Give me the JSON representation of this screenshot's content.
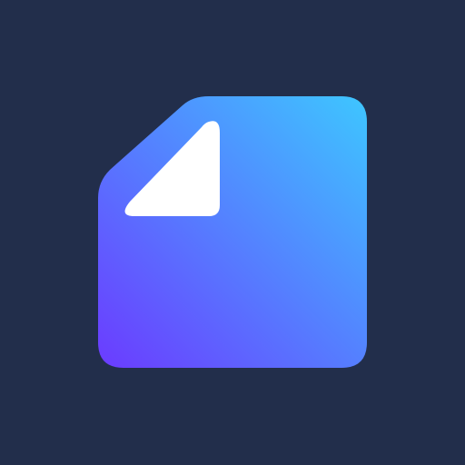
{
  "background_color": "#222e4b",
  "icon": {
    "name": "document-icon",
    "gradient_start": "#6b3bff",
    "gradient_end": "#3ec6ff",
    "fold_color": "#ffffff"
  }
}
